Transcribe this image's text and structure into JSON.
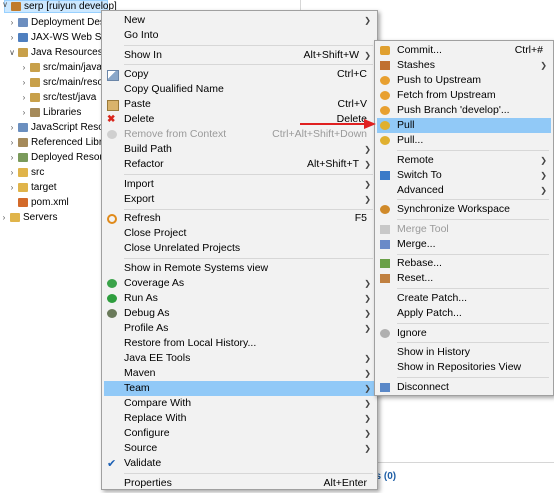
{
  "tree": {
    "rows": [
      {
        "label": "serp [ruiyun develop]",
        "indent": 0,
        "expanded": true,
        "selected": true,
        "icon": "project-icon",
        "color": "#c07b2c"
      },
      {
        "label": "Deployment Descriptor: serp",
        "indent": 1,
        "expanded": false,
        "icon": "descriptor-icon",
        "color": "#6c8ebf"
      },
      {
        "label": "JAX-WS Web Services",
        "indent": 1,
        "expanded": false,
        "icon": "webservice-icon",
        "color": "#4f7fbf"
      },
      {
        "label": "Java Resources",
        "indent": 1,
        "expanded": true,
        "icon": "java-resources-icon",
        "color": "#c8a04a"
      },
      {
        "label": "src/main/java",
        "indent": 2,
        "expanded": false,
        "icon": "package-folder-icon",
        "color": "#c8a04a"
      },
      {
        "label": "src/main/resources",
        "indent": 2,
        "expanded": false,
        "icon": "package-folder-icon",
        "color": "#c8a04a"
      },
      {
        "label": "src/test/java",
        "indent": 2,
        "expanded": false,
        "icon": "package-folder-icon",
        "color": "#c8a04a"
      },
      {
        "label": "Libraries",
        "indent": 2,
        "expanded": false,
        "icon": "library-icon",
        "color": "#a58a5a"
      },
      {
        "label": "JavaScript Resources",
        "indent": 1,
        "expanded": false,
        "icon": "js-resources-icon",
        "color": "#6b8fbf"
      },
      {
        "label": "Referenced Libraries",
        "indent": 1,
        "expanded": false,
        "icon": "library-icon",
        "color": "#a58a5a"
      },
      {
        "label": "Deployed Resources",
        "indent": 1,
        "expanded": false,
        "icon": "deployed-icon",
        "color": "#7a9a5a"
      },
      {
        "label": "src",
        "indent": 1,
        "expanded": false,
        "icon": "folder-icon",
        "color": "#e0b44a"
      },
      {
        "label": "target",
        "indent": 1,
        "expanded": false,
        "icon": "folder-icon",
        "color": "#e0b44a"
      },
      {
        "label": "pom.xml",
        "indent": 1,
        "expanded": null,
        "icon": "xml-file-icon",
        "color": "#d36a2a"
      },
      {
        "label": "Servers",
        "indent": 0,
        "expanded": false,
        "icon": "servers-folder-icon",
        "color": "#e0b44a"
      }
    ]
  },
  "properties_tab": {
    "label": "es (0)"
  },
  "context_menu": {
    "items": [
      {
        "type": "item",
        "label": "New",
        "submenu": true
      },
      {
        "type": "item",
        "label": "Go Into"
      },
      {
        "type": "sep"
      },
      {
        "type": "item",
        "label": "Show In",
        "shortcut": "Alt+Shift+W",
        "submenu": true
      },
      {
        "type": "sep"
      },
      {
        "type": "item",
        "label": "Copy",
        "shortcut": "Ctrl+C",
        "icon": "copy-icon"
      },
      {
        "type": "item",
        "label": "Copy Qualified Name"
      },
      {
        "type": "item",
        "label": "Paste",
        "shortcut": "Ctrl+V",
        "icon": "paste-icon"
      },
      {
        "type": "item",
        "label": "Delete",
        "shortcut": "Delete",
        "icon": "delete-icon"
      },
      {
        "type": "item",
        "label": "Remove from Context",
        "shortcut": "Ctrl+Alt+Shift+Down",
        "disabled": true,
        "icon": "remove-context-icon"
      },
      {
        "type": "item",
        "label": "Build Path",
        "submenu": true
      },
      {
        "type": "item",
        "label": "Refactor",
        "shortcut": "Alt+Shift+T",
        "submenu": true
      },
      {
        "type": "sep"
      },
      {
        "type": "item",
        "label": "Import",
        "submenu": true
      },
      {
        "type": "item",
        "label": "Export",
        "submenu": true
      },
      {
        "type": "sep"
      },
      {
        "type": "item",
        "label": "Refresh",
        "shortcut": "F5",
        "icon": "refresh-icon"
      },
      {
        "type": "item",
        "label": "Close Project"
      },
      {
        "type": "item",
        "label": "Close Unrelated Projects"
      },
      {
        "type": "sep"
      },
      {
        "type": "item",
        "label": "Show in Remote Systems view"
      },
      {
        "type": "item",
        "label": "Coverage As",
        "submenu": true,
        "icon": "coverage-icon"
      },
      {
        "type": "item",
        "label": "Run As",
        "submenu": true,
        "icon": "run-icon"
      },
      {
        "type": "item",
        "label": "Debug As",
        "submenu": true,
        "icon": "debug-icon"
      },
      {
        "type": "item",
        "label": "Profile As",
        "submenu": true
      },
      {
        "type": "item",
        "label": "Restore from Local History..."
      },
      {
        "type": "item",
        "label": "Java EE Tools",
        "submenu": true
      },
      {
        "type": "item",
        "label": "Maven",
        "submenu": true
      },
      {
        "type": "item",
        "label": "Team",
        "submenu": true,
        "highlighted": true
      },
      {
        "type": "item",
        "label": "Compare With",
        "submenu": true
      },
      {
        "type": "item",
        "label": "Replace With",
        "submenu": true
      },
      {
        "type": "item",
        "label": "Configure",
        "submenu": true
      },
      {
        "type": "item",
        "label": "Source",
        "submenu": true
      },
      {
        "type": "item",
        "label": "Validate",
        "checked": true
      },
      {
        "type": "sep"
      },
      {
        "type": "item",
        "label": "Properties",
        "shortcut": "Alt+Enter"
      }
    ]
  },
  "team_menu": {
    "items": [
      {
        "type": "item",
        "label": "Commit...",
        "shortcut": "Ctrl+#",
        "icon": "commit-icon"
      },
      {
        "type": "item",
        "label": "Stashes",
        "submenu": true,
        "icon": "stash-icon"
      },
      {
        "type": "item",
        "label": "Push to Upstream",
        "icon": "push-icon"
      },
      {
        "type": "item",
        "label": "Fetch from Upstream",
        "icon": "fetch-icon"
      },
      {
        "type": "item",
        "label": "Push Branch 'develop'...",
        "icon": "push-branch-icon"
      },
      {
        "type": "item",
        "label": "Pull",
        "icon": "pull-icon",
        "highlighted": true
      },
      {
        "type": "item",
        "label": "Pull...",
        "icon": "pull-dialog-icon"
      },
      {
        "type": "sep"
      },
      {
        "type": "item",
        "label": "Remote",
        "submenu": true
      },
      {
        "type": "item",
        "label": "Switch To",
        "submenu": true,
        "icon": "switch-icon"
      },
      {
        "type": "item",
        "label": "Advanced",
        "submenu": true
      },
      {
        "type": "sep"
      },
      {
        "type": "item",
        "label": "Synchronize Workspace",
        "icon": "sync-icon"
      },
      {
        "type": "sep"
      },
      {
        "type": "item",
        "label": "Merge Tool",
        "disabled": true,
        "icon": "merge-tool-icon"
      },
      {
        "type": "item",
        "label": "Merge...",
        "icon": "merge-icon"
      },
      {
        "type": "sep"
      },
      {
        "type": "item",
        "label": "Rebase...",
        "icon": "rebase-icon"
      },
      {
        "type": "item",
        "label": "Reset...",
        "icon": "reset-icon"
      },
      {
        "type": "sep"
      },
      {
        "type": "item",
        "label": "Create Patch..."
      },
      {
        "type": "item",
        "label": "Apply Patch..."
      },
      {
        "type": "sep"
      },
      {
        "type": "item",
        "label": "Ignore",
        "icon": "ignore-icon"
      },
      {
        "type": "sep"
      },
      {
        "type": "item",
        "label": "Show in History"
      },
      {
        "type": "item",
        "label": "Show in Repositories View"
      },
      {
        "type": "sep"
      },
      {
        "type": "item",
        "label": "Disconnect",
        "icon": "disconnect-icon"
      }
    ]
  },
  "colors": {
    "highlight": "#91c9f7",
    "menu_bg": "#f2f2f2",
    "arrow": "#e02020"
  }
}
